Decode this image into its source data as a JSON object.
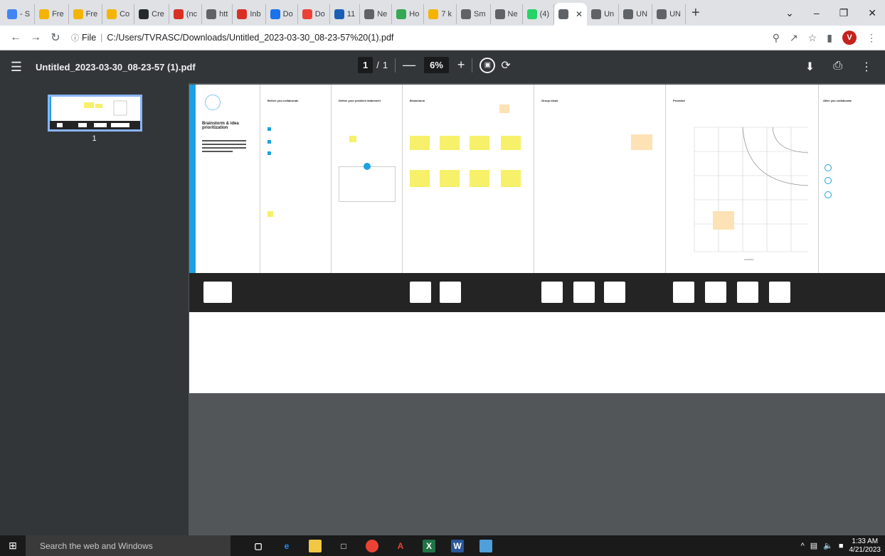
{
  "browser": {
    "tabs": [
      {
        "label": "- S",
        "icon": "slides-icon",
        "color": "#4285f4"
      },
      {
        "label": "Fre",
        "icon": "asterisk-icon",
        "color": "#f4b400"
      },
      {
        "label": "Fre",
        "icon": "asterisk-icon",
        "color": "#f4b400"
      },
      {
        "label": "Co",
        "icon": "asterisk-icon",
        "color": "#f4b400"
      },
      {
        "label": "Cre",
        "icon": "github-icon",
        "color": "#24292e"
      },
      {
        "label": "(nc",
        "icon": "gmail-icon",
        "color": "#d93025"
      },
      {
        "label": "htt",
        "icon": "chrome-icon",
        "color": "#5f6368"
      },
      {
        "label": "Inb",
        "icon": "gmail-icon",
        "color": "#d93025"
      },
      {
        "label": "Do",
        "icon": "download-icon",
        "color": "#1a73e8"
      },
      {
        "label": "Do",
        "icon": "heart-icon",
        "color": "#ea4335"
      },
      {
        "label": "11",
        "icon": "m-icon",
        "color": "#1a5fb4"
      },
      {
        "label": "Ne",
        "icon": "chrome-icon",
        "color": "#5f6368"
      },
      {
        "label": "Ho",
        "icon": "leaf-icon",
        "color": "#34a853"
      },
      {
        "label": "7 k",
        "icon": "asterisk-icon",
        "color": "#f4b400"
      },
      {
        "label": "Sm",
        "icon": "chrome-icon",
        "color": "#5f6368"
      },
      {
        "label": "Ne",
        "icon": "chrome-icon",
        "color": "#5f6368"
      },
      {
        "label": "(4)",
        "icon": "whatsapp-icon",
        "color": "#25d366"
      },
      {
        "label": "",
        "icon": "chrome-icon",
        "color": "#5f6368",
        "active": true
      },
      {
        "label": "Un",
        "icon": "chrome-icon",
        "color": "#5f6368"
      },
      {
        "label": "UN",
        "icon": "chrome-icon",
        "color": "#5f6368"
      },
      {
        "label": "UN",
        "icon": "chrome-icon",
        "color": "#5f6368"
      }
    ],
    "new_tab": "+",
    "address": {
      "scheme_label": "File",
      "url": "C:/Users/TVRASC/Downloads/Untitled_2023-03-30_08-23-57%20(1).pdf"
    },
    "profile_initial": "V"
  },
  "pdf_viewer": {
    "title": "Untitled_2023-03-30_08-23-57 (1).pdf",
    "current_page": "1",
    "page_sep": "/",
    "total_pages": "1",
    "zoom": "6%",
    "thumbnail_label": "1"
  },
  "document": {
    "intro_title": "Brainstorm & idea prioritization",
    "panels": [
      {
        "title": "Before you collaborate"
      },
      {
        "title": "Define your problem statement"
      },
      {
        "title": "Brainstorm"
      },
      {
        "title": "Group ideas"
      },
      {
        "title": "Prioritize"
      },
      {
        "title": "After you collaborate"
      }
    ],
    "axis_label": "Feasibility"
  },
  "taskbar": {
    "search_placeholder": "Search the web and Windows",
    "time": "1:33 AM",
    "date": "4/21/2023"
  },
  "colors": {
    "pdf_toolbar": "#323639",
    "doc_background": "#525659",
    "sticky": "#f6f06a",
    "accent_blue": "#1ba1e2"
  }
}
